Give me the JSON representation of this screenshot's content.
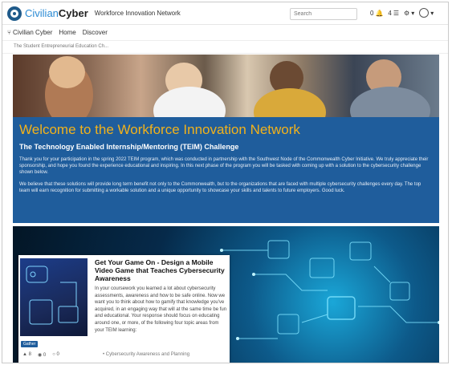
{
  "header": {
    "brand_prefix": "Civilian",
    "brand_suffix": "Cyber",
    "site_title": "Workforce Innovation Network",
    "search_placeholder": "Search",
    "notifications_count": "0",
    "messages_count": "4"
  },
  "nav": {
    "home_brand": "Civilian Cyber",
    "items": [
      "Home",
      "Discover"
    ]
  },
  "breadcrumb": "The Student Entrepreneurial Education Ch...",
  "welcome": {
    "title": "Welcome to the Workforce Innovation Network",
    "subtitle": "The Technology Enabled Internship/Mentoring (TEIM) Challenge",
    "paragraph1": "Thank you for your participation in the spring 2022 TEIM program, which was conducted in partnership with the Southwest Node of the Commonwealth Cyber Initiative. We truly appreciate their sponsorship, and hope you found the experience educational and inspiring. In this next phase of the program you will be tasked with coming up with a solution to the cybersecurity challenge shown below.",
    "paragraph2": "We believe that these solutions will provide long term benefit not only to the Commonwealth, but to the organizations that are faced with multiple cybersecurity challenges every day. The top team will earn recognition for submitting a workable solution and a unique opportunity to showcase your skills and talents to future employers. Good luck."
  },
  "card": {
    "title": "Get Your Game On - Design a Mobile Video Game that Teaches Cybersecurity Awareness",
    "body": "In your coursework you learned a lot about cybersecurity assessments, awareness and how to be safe online. Now we want you to think about how to gamify that knowledge you've acquired, in an engaging way that will at the same time be fun and educational. Your response should focus on educating around one, or more, of the following four topic areas from your TEIM learning:",
    "badge": "Gather",
    "stats": {
      "members": "8",
      "views": "0",
      "comments": "0"
    },
    "tag": "Cybersecurity Awareness and Planning"
  },
  "colors": {
    "brand_blue": "#1f5d9c",
    "welcome_gold": "#f2b21b",
    "accent_blue": "#2b8bd4"
  }
}
